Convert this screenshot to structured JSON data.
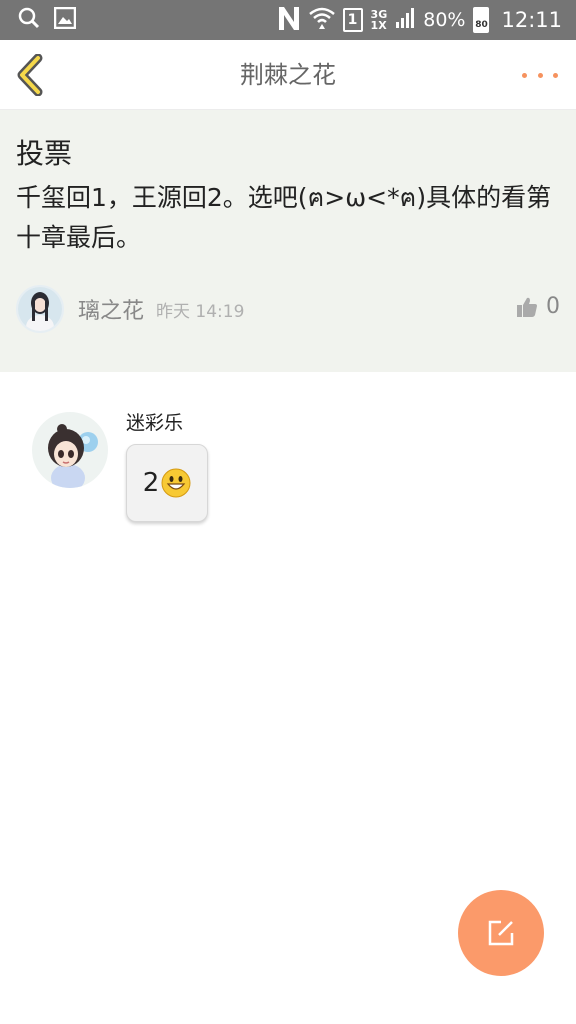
{
  "status_bar": {
    "icons": [
      "search-icon",
      "image-icon",
      "n-icon",
      "wifi-icon",
      "sim-1-icon",
      "network-icon",
      "battery-icon"
    ],
    "sim_slot": "1",
    "network_top": "3G",
    "network_bottom": "1X",
    "battery_percent": "80%",
    "battery_level": "80",
    "time": "12:11"
  },
  "header": {
    "title": "荆棘之花",
    "back_icon": "chevron-left-icon",
    "more_icon": "more-dots-icon",
    "accent_color": "#f6925e"
  },
  "post": {
    "title": "投票",
    "body": "千玺回1，王源回2。选吧(ฅ>ω<*ฅ)具体的看第十章最后。",
    "author": "璃之花",
    "time": "昨天 14:19",
    "like_count": "0",
    "like_icon": "thumbs-up-icon"
  },
  "reply": {
    "name": "迷彩乐",
    "content": "2",
    "emoji": "grin-emoji-icon"
  },
  "fab": {
    "icon": "edit-icon",
    "color": "#fb9a6a"
  }
}
